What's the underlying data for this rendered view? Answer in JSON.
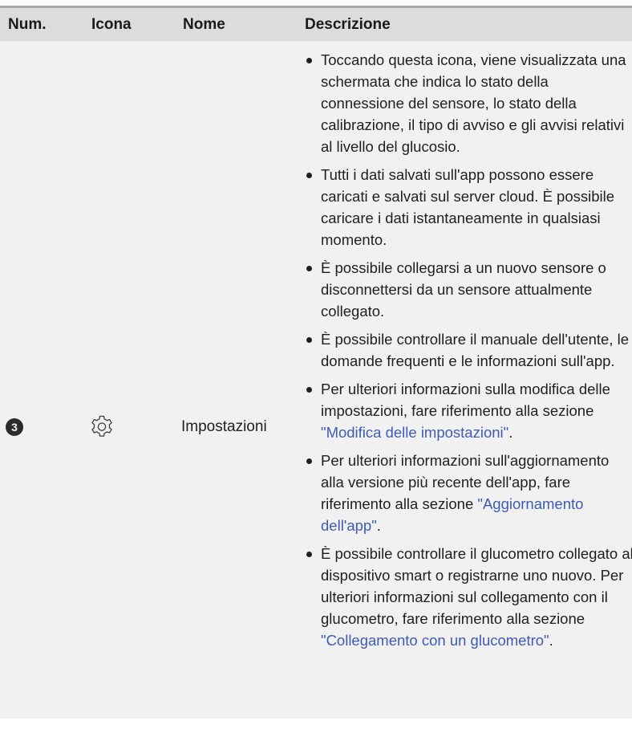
{
  "table": {
    "headers": {
      "num": "Num.",
      "icon": "Icona",
      "name": "Nome",
      "description": "Descrizione"
    },
    "row": {
      "number": "3",
      "icon": "gear-icon",
      "name": "Impostazioni",
      "bullets": [
        {
          "text": "Toccando questa icona, viene visualizzata una schermata che indica lo stato della connessione del sensore, lo stato della calibrazione, il tipo di avviso e gli avvisi relativi al livello del glucosio."
        },
        {
          "text": "Tutti i dati salvati sull'app possono essere caricati e salvati sul server cloud. È possibile caricare i dati istantaneamente in qualsiasi momento."
        },
        {
          "text": "È possibile collegarsi a un nuovo sensore o disconnettersi da un sensore attualmente collegato."
        },
        {
          "text": "È possibile controllare il manuale dell'utente, le domande frequenti e le informazioni sull'app."
        },
        {
          "before": "Per ulteriori informazioni sulla modifica delle impostazioni, fare riferimento alla sezione ",
          "link": "\"Modifica delle impostazioni\"",
          "after": "."
        },
        {
          "before": "Per ulteriori informazioni sull'aggiornamento alla versione più recente dell'app, fare riferimento alla sezione ",
          "link": "\"Aggiornamento dell'app\"",
          "after": "."
        },
        {
          "before": "È possibile controllare il glucometro collegato al dispositivo smart o registrarne uno nuovo. Per ulteriori informazioni sul collegamento con il glucometro, fare riferimento alla sezione ",
          "link": "\"Collegamento con un glucometro\"",
          "after": "."
        }
      ]
    }
  },
  "colors": {
    "header_bg": "#dcdcdc",
    "row_bg": "#f1f1f1",
    "link": "#3f5bb5",
    "text": "#1f1f1f"
  }
}
